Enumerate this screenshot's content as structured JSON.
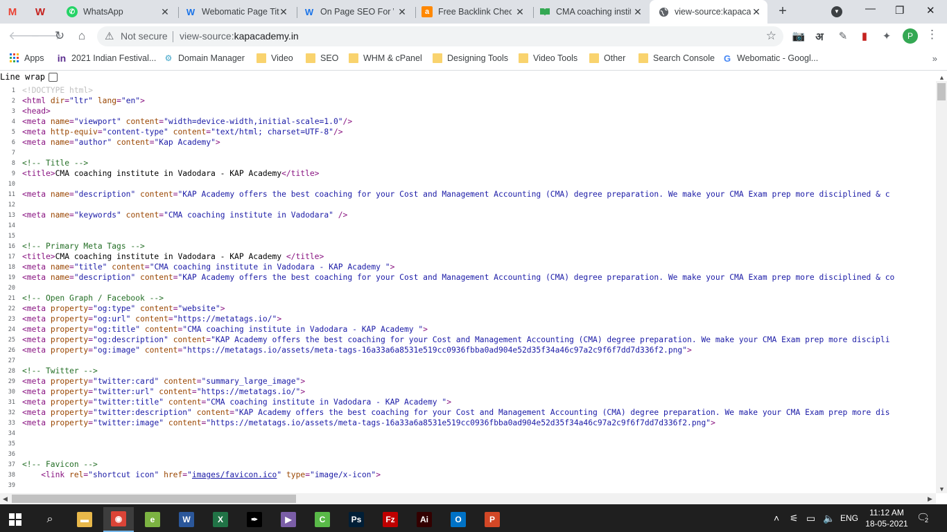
{
  "tabs": [
    {
      "icon": "gmail-icon",
      "glyph": "M",
      "color": "#ea4335",
      "title": "",
      "active": false
    },
    {
      "icon": "webomatic-icon",
      "glyph": "W",
      "color": "#c5221f",
      "title": "",
      "active": false
    },
    {
      "icon": "whatsapp-icon",
      "glyph": "✆",
      "color": "#25d366",
      "title": "WhatsApp",
      "active": false
    },
    {
      "icon": "webomatic-w-icon",
      "glyph": "W",
      "color": "#1a73e8",
      "title": "Webomatic Page Tit",
      "active": false
    },
    {
      "icon": "webomatic-w-icon",
      "glyph": "W",
      "color": "#1a73e8",
      "title": "On Page SEO For W",
      "active": false
    },
    {
      "icon": "ahrefs-icon",
      "glyph": "a",
      "color": "#ff8800",
      "title": "Free Backlink Check",
      "active": false
    },
    {
      "icon": "book-icon",
      "glyph": "📖",
      "color": "#34a853",
      "title": "CMA coaching instit",
      "active": false
    },
    {
      "icon": "globe-icon",
      "glyph": "🌐",
      "color": "#5f6368",
      "title": "view-source:kapaca",
      "active": true
    }
  ],
  "toolbar": {
    "not_secure": "Not secure",
    "url_prefix": "view-source:",
    "url_host": "kapacademy.in",
    "profile_initial": "P"
  },
  "bookmarks": [
    {
      "icon": "apps-grid-icon",
      "label": "Apps"
    },
    {
      "icon": "indian-festival-icon",
      "label": "2021 Indian Festival..."
    },
    {
      "icon": "domain-manager-icon",
      "label": "Domain Manager"
    },
    {
      "icon": "folder-icon",
      "label": "Video"
    },
    {
      "icon": "folder-icon",
      "label": "SEO"
    },
    {
      "icon": "folder-icon",
      "label": "WHM & cPanel"
    },
    {
      "icon": "folder-icon",
      "label": "Designing Tools"
    },
    {
      "icon": "folder-icon",
      "label": "Video Tools"
    },
    {
      "icon": "folder-icon",
      "label": "Other"
    },
    {
      "icon": "folder-icon",
      "label": "Search Console"
    },
    {
      "icon": "google-icon",
      "label": "Webomatic - Googl..."
    }
  ],
  "source": {
    "line_wrap_label": "Line wrap",
    "lines": [
      {
        "n": "1",
        "parts": [
          [
            "doc",
            "<!DOCTYPE html>"
          ]
        ]
      },
      {
        "n": "2",
        "parts": [
          [
            "tag",
            "<html "
          ],
          [
            "attr",
            "dir"
          ],
          [
            "tag",
            "="
          ],
          [
            "val",
            "\"ltr\""
          ],
          [
            "tag",
            " "
          ],
          [
            "attr",
            "lang"
          ],
          [
            "tag",
            "="
          ],
          [
            "val",
            "\"en\""
          ],
          [
            "tag",
            ">"
          ]
        ]
      },
      {
        "n": "3",
        "parts": [
          [
            "tag",
            "<head>"
          ]
        ]
      },
      {
        "n": "4",
        "parts": [
          [
            "tag",
            "<meta "
          ],
          [
            "attr",
            "name"
          ],
          [
            "tag",
            "="
          ],
          [
            "val",
            "\"viewport\""
          ],
          [
            "tag",
            " "
          ],
          [
            "attr",
            "content"
          ],
          [
            "tag",
            "="
          ],
          [
            "val",
            "\"width=device-width,initial-scale=1.0\""
          ],
          [
            "tag",
            "/>"
          ]
        ]
      },
      {
        "n": "5",
        "parts": [
          [
            "tag",
            "<meta "
          ],
          [
            "attr",
            "http-equiv"
          ],
          [
            "tag",
            "="
          ],
          [
            "val",
            "\"content-type\""
          ],
          [
            "tag",
            " "
          ],
          [
            "attr",
            "content"
          ],
          [
            "tag",
            "="
          ],
          [
            "val",
            "\"text/html; charset=UTF-8\""
          ],
          [
            "tag",
            "/>"
          ]
        ]
      },
      {
        "n": "6",
        "parts": [
          [
            "tag",
            "<meta "
          ],
          [
            "attr",
            "name"
          ],
          [
            "tag",
            "="
          ],
          [
            "val",
            "\"author\""
          ],
          [
            "tag",
            " "
          ],
          [
            "attr",
            "content"
          ],
          [
            "tag",
            "="
          ],
          [
            "val",
            "\"Kap Academy\""
          ],
          [
            "tag",
            ">"
          ]
        ]
      },
      {
        "n": "7",
        "parts": []
      },
      {
        "n": "8",
        "parts": [
          [
            "com",
            "<!-- Title -->"
          ]
        ]
      },
      {
        "n": "9",
        "parts": [
          [
            "tag",
            "<title>"
          ],
          [
            "txt",
            "CMA coaching institute in Vadodara - KAP Academy"
          ],
          [
            "tag",
            "</title>"
          ]
        ]
      },
      {
        "n": "10",
        "parts": []
      },
      {
        "n": "11",
        "parts": [
          [
            "tag",
            "<meta "
          ],
          [
            "attr",
            "name"
          ],
          [
            "tag",
            "="
          ],
          [
            "val",
            "\"description\""
          ],
          [
            "tag",
            " "
          ],
          [
            "attr",
            "content"
          ],
          [
            "tag",
            "="
          ],
          [
            "val",
            "\"KAP Academy offers the best coaching for your Cost and Management Accounting (CMA) degree preparation. We make your CMA Exam prep more disciplined & c"
          ]
        ]
      },
      {
        "n": "12",
        "parts": []
      },
      {
        "n": "13",
        "parts": [
          [
            "tag",
            "<meta "
          ],
          [
            "attr",
            "name"
          ],
          [
            "tag",
            "="
          ],
          [
            "val",
            "\"keywords\""
          ],
          [
            "tag",
            " "
          ],
          [
            "attr",
            "content"
          ],
          [
            "tag",
            "="
          ],
          [
            "val",
            "\"CMA coaching institute in Vadodara\""
          ],
          [
            "tag",
            " />"
          ]
        ]
      },
      {
        "n": "14",
        "parts": []
      },
      {
        "n": "15",
        "parts": []
      },
      {
        "n": "16",
        "parts": [
          [
            "com",
            "<!-- Primary Meta Tags -->"
          ]
        ]
      },
      {
        "n": "17",
        "parts": [
          [
            "tag",
            "<title>"
          ],
          [
            "txt",
            "CMA coaching institute in Vadodara - KAP Academy "
          ],
          [
            "tag",
            "</title>"
          ]
        ]
      },
      {
        "n": "18",
        "parts": [
          [
            "tag",
            "<meta "
          ],
          [
            "attr",
            "name"
          ],
          [
            "tag",
            "="
          ],
          [
            "val",
            "\"title\""
          ],
          [
            "tag",
            " "
          ],
          [
            "attr",
            "content"
          ],
          [
            "tag",
            "="
          ],
          [
            "val",
            "\"CMA coaching institute in Vadodara - KAP Academy \""
          ],
          [
            "tag",
            ">"
          ]
        ]
      },
      {
        "n": "19",
        "parts": [
          [
            "tag",
            "<meta "
          ],
          [
            "attr",
            "name"
          ],
          [
            "tag",
            "="
          ],
          [
            "val",
            "\"description\""
          ],
          [
            "tag",
            " "
          ],
          [
            "attr",
            "content"
          ],
          [
            "tag",
            "="
          ],
          [
            "val",
            "\"KAP Academy offers the best coaching for your Cost and Management Accounting (CMA) degree preparation. We make your CMA Exam prep more disciplined & co"
          ]
        ]
      },
      {
        "n": "20",
        "parts": []
      },
      {
        "n": "21",
        "parts": [
          [
            "com",
            "<!-- Open Graph / Facebook -->"
          ]
        ]
      },
      {
        "n": "22",
        "parts": [
          [
            "tag",
            "<meta "
          ],
          [
            "attr",
            "property"
          ],
          [
            "tag",
            "="
          ],
          [
            "val",
            "\"og:type\""
          ],
          [
            "tag",
            " "
          ],
          [
            "attr",
            "content"
          ],
          [
            "tag",
            "="
          ],
          [
            "val",
            "\"website\""
          ],
          [
            "tag",
            ">"
          ]
        ]
      },
      {
        "n": "23",
        "parts": [
          [
            "tag",
            "<meta "
          ],
          [
            "attr",
            "property"
          ],
          [
            "tag",
            "="
          ],
          [
            "val",
            "\"og:url\""
          ],
          [
            "tag",
            " "
          ],
          [
            "attr",
            "content"
          ],
          [
            "tag",
            "="
          ],
          [
            "val",
            "\"https://metatags.io/\""
          ],
          [
            "tag",
            ">"
          ]
        ]
      },
      {
        "n": "24",
        "parts": [
          [
            "tag",
            "<meta "
          ],
          [
            "attr",
            "property"
          ],
          [
            "tag",
            "="
          ],
          [
            "val",
            "\"og:title\""
          ],
          [
            "tag",
            " "
          ],
          [
            "attr",
            "content"
          ],
          [
            "tag",
            "="
          ],
          [
            "val",
            "\"CMA coaching institute in Vadodara - KAP Academy \""
          ],
          [
            "tag",
            ">"
          ]
        ]
      },
      {
        "n": "25",
        "parts": [
          [
            "tag",
            "<meta "
          ],
          [
            "attr",
            "property"
          ],
          [
            "tag",
            "="
          ],
          [
            "val",
            "\"og:description\""
          ],
          [
            "tag",
            " "
          ],
          [
            "attr",
            "content"
          ],
          [
            "tag",
            "="
          ],
          [
            "val",
            "\"KAP Academy offers the best coaching for your Cost and Management Accounting (CMA) degree preparation. We make your CMA Exam prep more discipli"
          ]
        ]
      },
      {
        "n": "26",
        "parts": [
          [
            "tag",
            "<meta "
          ],
          [
            "attr",
            "property"
          ],
          [
            "tag",
            "="
          ],
          [
            "val",
            "\"og:image\""
          ],
          [
            "tag",
            " "
          ],
          [
            "attr",
            "content"
          ],
          [
            "tag",
            "="
          ],
          [
            "val",
            "\"https://metatags.io/assets/meta-tags-16a33a6a8531e519cc0936fbba0ad904e52d35f34a46c97a2c9f6f7dd7d336f2.png\""
          ],
          [
            "tag",
            ">"
          ]
        ]
      },
      {
        "n": "27",
        "parts": []
      },
      {
        "n": "28",
        "parts": [
          [
            "com",
            "<!-- Twitter -->"
          ]
        ]
      },
      {
        "n": "29",
        "parts": [
          [
            "tag",
            "<meta "
          ],
          [
            "attr",
            "property"
          ],
          [
            "tag",
            "="
          ],
          [
            "val",
            "\"twitter:card\""
          ],
          [
            "tag",
            " "
          ],
          [
            "attr",
            "content"
          ],
          [
            "tag",
            "="
          ],
          [
            "val",
            "\"summary_large_image\""
          ],
          [
            "tag",
            ">"
          ]
        ]
      },
      {
        "n": "30",
        "parts": [
          [
            "tag",
            "<meta "
          ],
          [
            "attr",
            "property"
          ],
          [
            "tag",
            "="
          ],
          [
            "val",
            "\"twitter:url\""
          ],
          [
            "tag",
            " "
          ],
          [
            "attr",
            "content"
          ],
          [
            "tag",
            "="
          ],
          [
            "val",
            "\"https://metatags.io/\""
          ],
          [
            "tag",
            ">"
          ]
        ]
      },
      {
        "n": "31",
        "parts": [
          [
            "tag",
            "<meta "
          ],
          [
            "attr",
            "property"
          ],
          [
            "tag",
            "="
          ],
          [
            "val",
            "\"twitter:title\""
          ],
          [
            "tag",
            " "
          ],
          [
            "attr",
            "content"
          ],
          [
            "tag",
            "="
          ],
          [
            "val",
            "\"CMA coaching institute in Vadodara - KAP Academy \""
          ],
          [
            "tag",
            ">"
          ]
        ]
      },
      {
        "n": "32",
        "parts": [
          [
            "tag",
            "<meta "
          ],
          [
            "attr",
            "property"
          ],
          [
            "tag",
            "="
          ],
          [
            "val",
            "\"twitter:description\""
          ],
          [
            "tag",
            " "
          ],
          [
            "attr",
            "content"
          ],
          [
            "tag",
            "="
          ],
          [
            "val",
            "\"KAP Academy offers the best coaching for your Cost and Management Accounting (CMA) degree preparation. We make your CMA Exam prep more dis"
          ]
        ]
      },
      {
        "n": "33",
        "parts": [
          [
            "tag",
            "<meta "
          ],
          [
            "attr",
            "property"
          ],
          [
            "tag",
            "="
          ],
          [
            "val",
            "\"twitter:image\""
          ],
          [
            "tag",
            " "
          ],
          [
            "attr",
            "content"
          ],
          [
            "tag",
            "="
          ],
          [
            "val",
            "\"https://metatags.io/assets/meta-tags-16a33a6a8531e519cc0936fbba0ad904e52d35f34a46c97a2c9f6f7dd7d336f2.png\""
          ],
          [
            "tag",
            ">"
          ]
        ]
      },
      {
        "n": "34",
        "parts": []
      },
      {
        "n": "35",
        "parts": []
      },
      {
        "n": "36",
        "parts": []
      },
      {
        "n": "37",
        "parts": [
          [
            "com",
            "<!-- Favicon -->"
          ]
        ]
      },
      {
        "n": "38",
        "parts": [
          [
            "tag",
            "    <link "
          ],
          [
            "attr",
            "rel"
          ],
          [
            "tag",
            "="
          ],
          [
            "val",
            "\"shortcut icon\""
          ],
          [
            "tag",
            " "
          ],
          [
            "attr",
            "href"
          ],
          [
            "tag",
            "="
          ],
          [
            "val",
            "\""
          ],
          [
            "lnk",
            "images/favicon.ico"
          ],
          [
            "val",
            "\""
          ],
          [
            "tag",
            " "
          ],
          [
            "attr",
            "type"
          ],
          [
            "tag",
            "="
          ],
          [
            "val",
            "\"image/x-icon\""
          ],
          [
            "tag",
            ">"
          ]
        ]
      },
      {
        "n": "39",
        "parts": []
      }
    ]
  },
  "taskbar": {
    "apps": [
      {
        "icon": "file-explorer-icon",
        "glyph": "▬",
        "bg": "#e8b84a",
        "active": false
      },
      {
        "icon": "chrome-icon",
        "glyph": "◉",
        "bg": "#db4437",
        "active": true
      },
      {
        "icon": "aside-green-icon",
        "glyph": "e",
        "bg": "#7cb342",
        "active": false
      },
      {
        "icon": "word-icon",
        "glyph": "W",
        "bg": "#2b579a",
        "active": false
      },
      {
        "icon": "excel-icon",
        "glyph": "X",
        "bg": "#217346",
        "active": false
      },
      {
        "icon": "inkscape-icon",
        "glyph": "✒",
        "bg": "#000000",
        "active": false
      },
      {
        "icon": "media-player-icon",
        "glyph": "▶",
        "bg": "#7b5ea7",
        "active": false
      },
      {
        "icon": "camtasia-icon",
        "glyph": "C",
        "bg": "#59b948",
        "active": false
      },
      {
        "icon": "photoshop-icon",
        "glyph": "Ps",
        "bg": "#001e36",
        "active": false
      },
      {
        "icon": "filezilla-icon",
        "glyph": "Fz",
        "bg": "#bf0000",
        "active": false
      },
      {
        "icon": "illustrator-icon",
        "glyph": "Ai",
        "bg": "#330000",
        "active": false
      },
      {
        "icon": "outlook-icon",
        "glyph": "O",
        "bg": "#0072c6",
        "active": false
      },
      {
        "icon": "powerpoint-icon",
        "glyph": "P",
        "bg": "#d24726",
        "active": false
      }
    ],
    "language": "ENG",
    "time": "11:12 AM",
    "date": "18-05-2021",
    "notifications": "2"
  }
}
